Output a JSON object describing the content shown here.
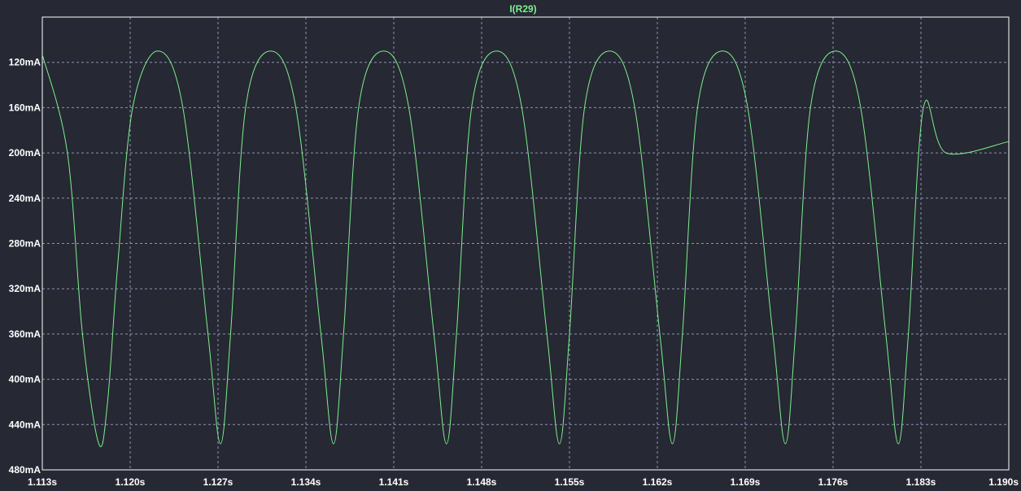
{
  "colors": {
    "background": "#262833",
    "plot_border": "#ffffff",
    "grid": "#8e93b5",
    "trace": "#7cf08e",
    "text": "#ffffff"
  },
  "chart_data": {
    "type": "line",
    "title": "",
    "xlabel": "",
    "ylabel": "",
    "grid": true,
    "xlim": [
      1.113,
      1.19
    ],
    "ylim": [
      480,
      80
    ],
    "x_tick_labels": [
      "1.113s",
      "1.120s",
      "1.127s",
      "1.134s",
      "1.141s",
      "1.148s",
      "1.155s",
      "1.162s",
      "1.169s",
      "1.176s",
      "1.183s",
      "1.190s"
    ],
    "x_ticks": [
      1.113,
      1.12,
      1.127,
      1.134,
      1.141,
      1.148,
      1.155,
      1.162,
      1.169,
      1.176,
      1.183,
      1.19
    ],
    "y_tick_labels": [
      "120mA",
      "160mA",
      "200mA",
      "240mA",
      "280mA",
      "320mA",
      "360mA",
      "400mA",
      "440mA",
      "480mA"
    ],
    "y_ticks": [
      120,
      160,
      200,
      240,
      280,
      320,
      360,
      400,
      440,
      480
    ],
    "series": [
      {
        "name": "I(R29)",
        "unit": "mA",
        "x": [
          1.113,
          1.115,
          1.1162,
          1.1175,
          1.1182,
          1.119,
          1.1202,
          1.1222,
          1.1242,
          1.1262,
          1.1272,
          1.128,
          1.1292,
          1.1312,
          1.1332,
          1.1352,
          1.1362,
          1.137,
          1.1382,
          1.1402,
          1.1422,
          1.1442,
          1.1452,
          1.146,
          1.1472,
          1.1492,
          1.1512,
          1.1532,
          1.1542,
          1.155,
          1.1562,
          1.1582,
          1.1602,
          1.1622,
          1.1632,
          1.164,
          1.1652,
          1.1672,
          1.1692,
          1.1712,
          1.1722,
          1.173,
          1.1742,
          1.1762,
          1.1782,
          1.1802,
          1.1812,
          1.182,
          1.1832,
          1.185,
          1.19
        ],
        "y": [
          113,
          200,
          360,
          457,
          420,
          300,
          160,
          110,
          160,
          360,
          457,
          360,
          160,
          110,
          160,
          360,
          457,
          360,
          160,
          110,
          160,
          360,
          457,
          360,
          160,
          110,
          160,
          360,
          457,
          360,
          160,
          110,
          160,
          360,
          457,
          360,
          160,
          110,
          160,
          360,
          457,
          360,
          160,
          110,
          160,
          360,
          457,
          360,
          160,
          200,
          190
        ]
      }
    ]
  }
}
